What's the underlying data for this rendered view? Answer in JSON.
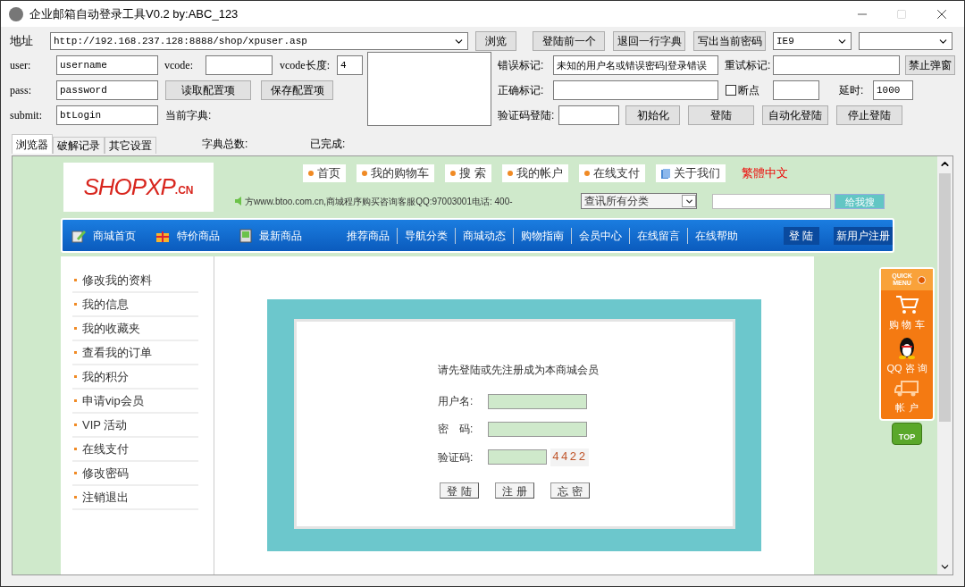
{
  "window": {
    "title": "企业邮箱自动登录工具V0.2 by:ABC_123"
  },
  "controls": {
    "address_label": "地址",
    "address": "http://192.168.237.128:8888/shop/xpuser.asp",
    "browse_button": "浏览",
    "top_buttons": [
      "登陆前一个",
      "退回一行字典",
      "写出当前密码"
    ],
    "browser_select": "IE9",
    "fields": [
      {
        "label": "user:",
        "value": "username"
      },
      {
        "label": "pass:",
        "value": "password"
      },
      {
        "label": "submit:",
        "value": "btLogin"
      }
    ],
    "vcode": {
      "label": "vcode:"
    },
    "vcode_length": {
      "label": "vcode长度:",
      "value": "4"
    },
    "config_buttons": [
      "读取配置项",
      "保存配置项"
    ],
    "current_dict_label": "当前字典:",
    "error_mark": {
      "label": "错误标记:",
      "value": "未知的用户名或错误密码|登录错误"
    },
    "retry_mark": {
      "label": "重试标记:"
    },
    "block_popup_button": "禁止弹窗",
    "correct_mark": {
      "label": "正确标记:"
    },
    "breakpoint": {
      "label": "断点",
      "checked": false
    },
    "delay": {
      "label": "延时:",
      "value": "1000"
    },
    "captcha_login": {
      "label": "验证码登陆:"
    },
    "action_buttons": [
      "初始化",
      "登陆",
      "自动化登陆",
      "停止登陆"
    ]
  },
  "tabs": [
    {
      "label": "浏览器",
      "selected": true
    },
    {
      "label": "破解记录",
      "selected": false
    },
    {
      "label": "其它设置",
      "selected": false
    }
  ],
  "dict_total_label": "字典总数:",
  "done_label": "已完成:",
  "web": {
    "logo": {
      "main": "SHOPXP",
      "suffix": ".CN"
    },
    "top_links": [
      {
        "label": "首页",
        "kind": "dot"
      },
      {
        "label": "我的购物车",
        "kind": "dot"
      },
      {
        "label": "搜 索",
        "kind": "dot"
      },
      {
        "label": "我的帐户",
        "kind": "dot"
      },
      {
        "label": "在线支付",
        "kind": "dot"
      },
      {
        "label": "关于我们",
        "kind": "page"
      },
      {
        "label": "繁體中文",
        "kind": "plain"
      }
    ],
    "notice": "方www.btoo.com.cn,商城程序购买咨询客服QQ:97003001电话: 400-",
    "category_select": "查讯所有分类",
    "search_button": "给我搜",
    "nav_icons": [
      {
        "label": "商城首页",
        "kind": "pencil"
      },
      {
        "label": "特价商品",
        "kind": "gift"
      },
      {
        "label": "最新商品",
        "kind": "device"
      }
    ],
    "nav_links": [
      "推荐商品",
      "导航分类",
      "商城动态",
      "购物指南",
      "会员中心",
      "在线留言",
      "在线帮助"
    ],
    "nav_buttons": [
      "登 陆",
      "新用户注册"
    ],
    "sidebar": [
      "修改我的资料",
      "我的信息",
      "我的收藏夹",
      "查看我的订单",
      "我的积分",
      "申请vip会员",
      "VIP 活动",
      "在线支付",
      "修改密码",
      "注销退出"
    ],
    "login": {
      "prompt": "请先登陆或先注册成为本商城会员",
      "fields": [
        {
          "label": "用户名:",
          "kind": "wide"
        },
        {
          "label": "密　码:",
          "kind": "wide"
        },
        {
          "label": "验证码:",
          "kind": "captcha"
        }
      ],
      "captcha": "4422",
      "buttons": [
        "登 陆",
        "注 册",
        "忘 密"
      ]
    },
    "quick_menu": {
      "title": "QUICK MENU",
      "items": [
        {
          "label": "购 物 车",
          "kind": "cart"
        },
        {
          "label": "QQ 咨 询",
          "kind": "penguin"
        },
        {
          "label": "帐 户",
          "kind": "truck"
        }
      ],
      "top_button": "TOP"
    }
  }
}
